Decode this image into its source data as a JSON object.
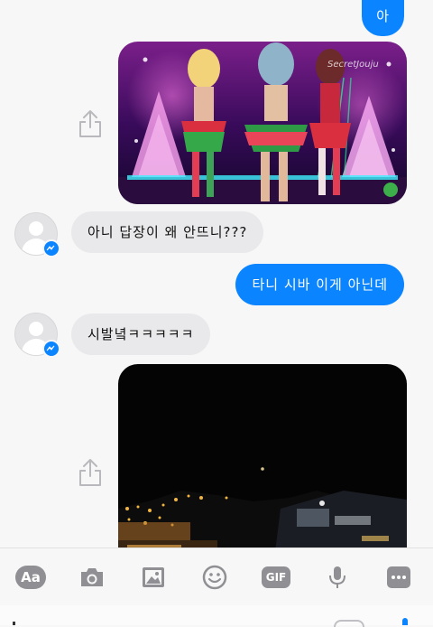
{
  "messages": {
    "out_1": "아",
    "in_1": "아니 답장이 왜 안뜨니???",
    "out_2": "타니 시바 이게 아닌데",
    "in_2": "시발녘ㅋㅋㅋㅋㅋ"
  },
  "photo_1": {
    "watermark": "SecretJouju"
  },
  "toolbar": {
    "aa_label": "Aa",
    "gif_label": "GIF",
    "icons": [
      "aa-icon",
      "camera-icon",
      "image-icon",
      "emoji-icon",
      "gif-icon",
      "microphone-icon",
      "more-icon"
    ]
  },
  "colors": {
    "accent": "#0a84ff",
    "incoming_bubble": "#e9e9eb",
    "background": "#f7f7f7"
  }
}
